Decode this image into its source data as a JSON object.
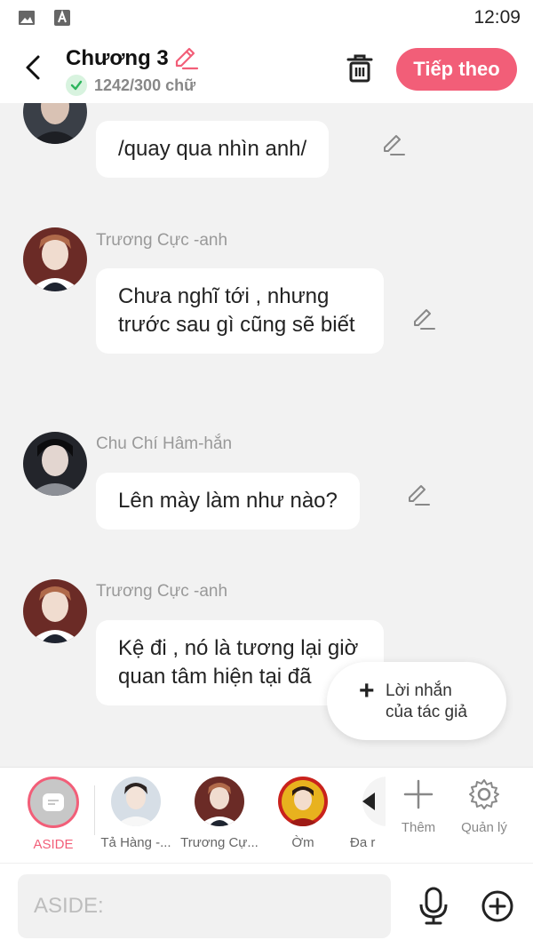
{
  "status": {
    "time": "12:09"
  },
  "header": {
    "chapter_title": "Chương 3",
    "word_count": "1242/300 chữ",
    "next_label": "Tiếp theo"
  },
  "messages": [
    {
      "sender": "",
      "text": "/quay qua nhìn anh/"
    },
    {
      "sender": "Trương Cực -anh",
      "text": "Chưa nghĩ tới , nhưng trước sau gì cũng sẽ biết"
    },
    {
      "sender": "Chu Chí Hâm-hắn",
      "text": "Lên mày làm như nào?"
    },
    {
      "sender": "Trương Cực -anh",
      "text": "Kệ đi , nó là tương lại giờ quan tâm hiện tại đã"
    }
  ],
  "author_note": {
    "plus": "+",
    "line1": "Lời nhắn",
    "line2": "của tác giả"
  },
  "characters": [
    {
      "name": "ASIDE"
    },
    {
      "name": "Tả Hàng -..."
    },
    {
      "name": "Trương Cự..."
    },
    {
      "name": "Ờm"
    },
    {
      "name": "Đa r"
    }
  ],
  "tools": {
    "add_label": "Thêm",
    "manage_label": "Quản lý"
  },
  "input": {
    "placeholder": "ASIDE:"
  },
  "colors": {
    "accent": "#f25e78",
    "background": "#f2f2f2"
  }
}
